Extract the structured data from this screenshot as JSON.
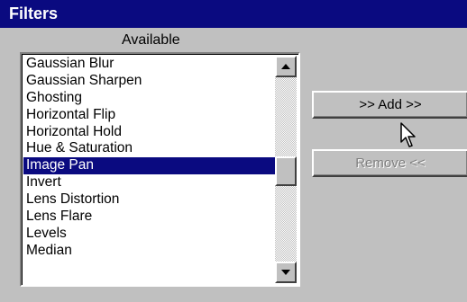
{
  "window": {
    "title": "Filters"
  },
  "available": {
    "label": "Available",
    "items": [
      "Gaussian Blur",
      "Gaussian Sharpen",
      "Ghosting",
      "Horizontal Flip",
      "Horizontal Hold",
      "Hue & Saturation",
      "Image Pan",
      "Invert",
      "Lens Distortion",
      "Lens Flare",
      "Levels",
      "Median"
    ],
    "selected": "Image Pan"
  },
  "buttons": {
    "add_label": ">> Add >>",
    "remove_label": "Remove <<"
  },
  "scrollbar": {
    "up_icon": "arrow-up-icon",
    "down_icon": "arrow-down-icon"
  },
  "cursor_icon": "mouse-pointer-icon",
  "colors": {
    "titlebar": "#0a0a80",
    "selection": "#0a0a80",
    "face": "#c0c0c0",
    "disabled_text": "#808080"
  }
}
